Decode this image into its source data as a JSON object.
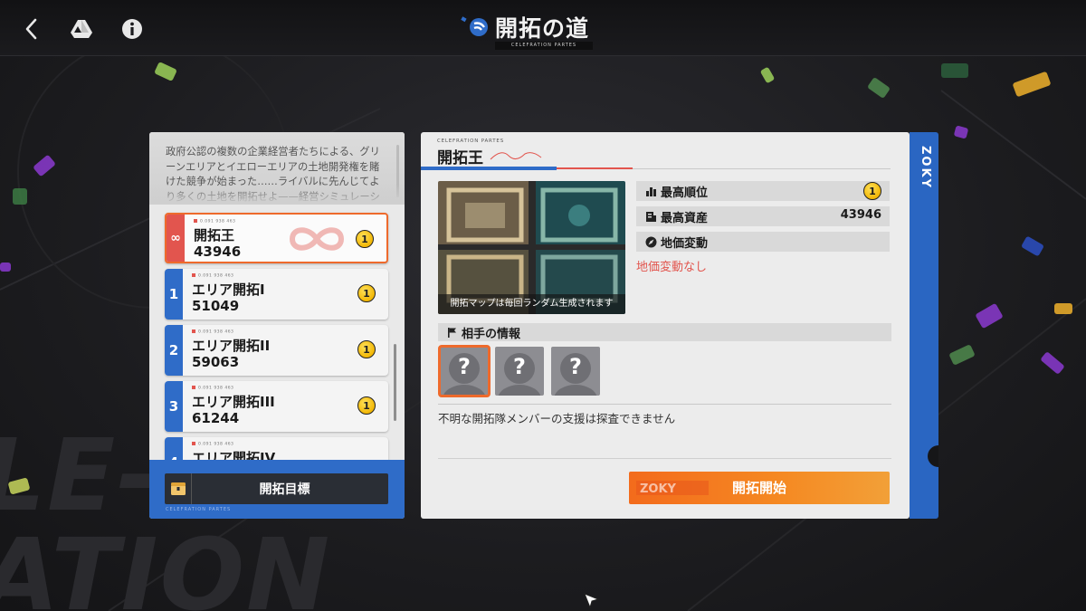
{
  "topbar": {
    "title": "開拓の道",
    "subtitle": "CELEFRATION PARTES",
    "back_icon": "chevron-left-icon",
    "drive_icon": "drive-icon",
    "info_icon": "info-icon"
  },
  "background": {
    "watermark": "LE-\nATION"
  },
  "left_panel": {
    "description": "政府公認の複数の企業経営者たちによる、グリーンエリアとイエローエリアの土地開発権を賭けた競争が始まった……ライバルに先んじてより多くの土地を開拓せよ——経営シミュレーション対戦！『開拓の道』へ。",
    "routes": [
      {
        "badge": "∞",
        "code": "0.091 938 463",
        "name": "開拓王",
        "score": "43946",
        "rank": "1",
        "selected": true
      },
      {
        "badge": "1",
        "code": "0.091 938 463",
        "name": "エリア開拓I",
        "score": "51049",
        "rank": "1"
      },
      {
        "badge": "2",
        "code": "0.091 938 463",
        "name": "エリア開拓II",
        "score": "59063",
        "rank": "1"
      },
      {
        "badge": "3",
        "code": "0.091 938 463",
        "name": "エリア開拓III",
        "score": "61244",
        "rank": "1"
      },
      {
        "badge": "4",
        "code": "0.091 938 463",
        "name": "エリア開拓IV",
        "score": "",
        "rank": ""
      }
    ],
    "goal_button": "開拓目標",
    "footer_tag": "CELEFRATION PARTES"
  },
  "right_panel": {
    "tag": "CELEFRATION PARTES",
    "title": "開拓王",
    "map_caption": "開拓マップは毎回ランダム生成されます",
    "stats": {
      "best_rank_label": "最高順位",
      "best_rank_value": "1",
      "best_assets_label": "最高資産",
      "best_assets_value": "43946",
      "land_change_label": "地価変動",
      "land_change_value": "地価変動なし"
    },
    "opponent_label": "相手の情報",
    "avatar_glyph": "?",
    "opponent_note": "不明な開拓隊メンバーの支援は探査できません",
    "start_button": "開拓開始",
    "start_logo": "ZOKY"
  },
  "side_strip": {
    "text": "ZOKY"
  },
  "colors": {
    "accent_blue": "#2f6cc8",
    "accent_orange": "#f36b1c",
    "accent_red": "#e2554e",
    "coin_yellow": "#f2b705"
  }
}
